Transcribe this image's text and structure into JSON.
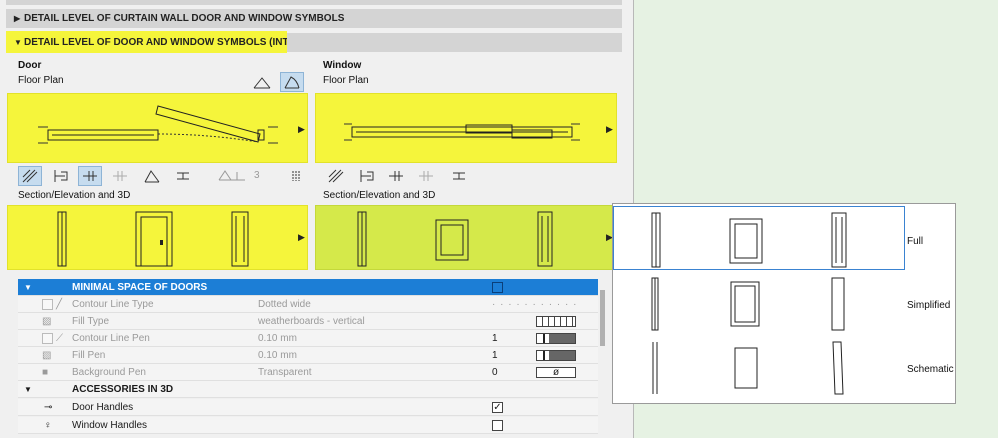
{
  "sections": {
    "curtain": "DETAIL LEVEL OF CURTAIN WALL DOOR AND WINDOW SYMBOLS",
    "door_window": "DETAIL LEVEL OF DOOR AND WINDOW SYMBOLS (INT)"
  },
  "door": {
    "title": "Door",
    "floor_plan": "Floor Plan",
    "section": "Section/Elevation and 3D",
    "counter_value": "3"
  },
  "window": {
    "title": "Window",
    "floor_plan": "Floor Plan",
    "section": "Section/Elevation and 3D"
  },
  "table": {
    "minimal_space": "MINIMAL SPACE OF DOORS",
    "rows": [
      {
        "label": "Contour Line Type",
        "value": "Dotted wide",
        "num": ""
      },
      {
        "label": "Fill Type",
        "value": "weatherboards - vertical",
        "num": ""
      },
      {
        "label": "Contour Line Pen",
        "value": "0.10 mm",
        "num": "1"
      },
      {
        "label": "Fill Pen",
        "value": "0.10 mm",
        "num": "1"
      },
      {
        "label": "Background Pen",
        "value": "Transparent",
        "num": "0"
      }
    ],
    "accessories": "ACCESSORIES IN 3D",
    "door_handles": "Door Handles",
    "window_handles": "Window Handles"
  },
  "popup": {
    "full": "Full",
    "simplified": "Simplified",
    "schematic": "Schematic"
  },
  "colors": {
    "highlight": "#f5f53b",
    "green_highlight": "#d5e94a",
    "selection": "#1c7ed6"
  },
  "icons": {
    "collapse": "triangle-right-icon",
    "expand": "triangle-down-icon",
    "preview_more": "arrow-right-icon"
  }
}
